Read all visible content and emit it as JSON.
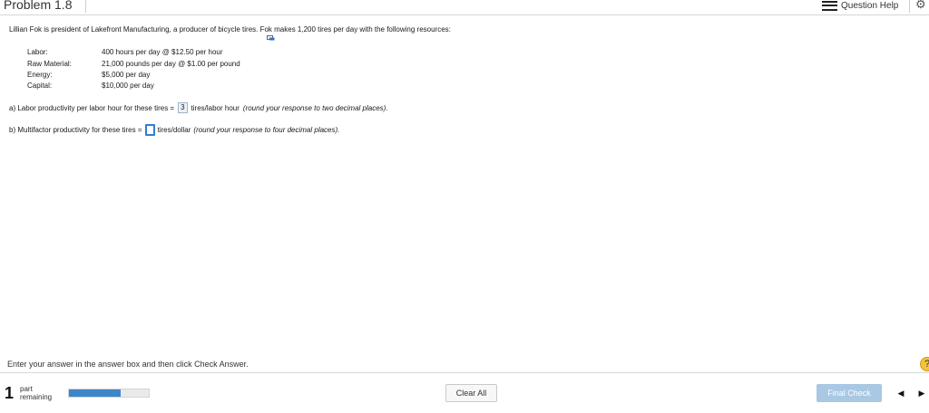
{
  "header": {
    "title": "Problem 1.8",
    "question_help": "Question Help",
    "icons": {
      "menu": "hamburger-icon",
      "settings": "gear-icon"
    }
  },
  "problem": {
    "intro": "Lillian Fok is president of Lakefront Manufacturing, a producer of bicycle tires. Fok makes 1,200 tires per day with the following resources:",
    "resources": [
      {
        "label": "Labor:",
        "value": "400 hours per day @ $12.50 per hour"
      },
      {
        "label": "Raw Material:",
        "value": "21,000 pounds per day @ $1.00 per pound"
      },
      {
        "label": "Energy:",
        "value": "$5,000 per day"
      },
      {
        "label": "Capital:",
        "value": "$10,000 per day"
      }
    ],
    "part_a": {
      "prefix": "a) Labor productivity per labor hour for these tires =",
      "answer": "3",
      "unit": "tires/labor hour",
      "hint": "(round your response to two decimal places)."
    },
    "part_b": {
      "prefix": "b) Multifactor productivity for these tires =",
      "answer": "",
      "unit": "tires/dollar",
      "hint": "(round your response to four decimal places)."
    }
  },
  "footer": {
    "instruction": "Enter your answer in the answer box and then click Check Answer.",
    "parts_remaining_count": "1",
    "parts_remaining_label_1": "part",
    "parts_remaining_label_2": "remaining",
    "progress_fraction": 0.65,
    "clear_all": "Clear All",
    "final_check": "Final Check",
    "help_bubble": "?",
    "nav_prev": "◀",
    "nav_next": "▶"
  },
  "colors": {
    "accent": "#3c86c9",
    "final_check_bg": "#a9c8e3",
    "help_bubble": "#f3c33b",
    "input_focus_border": "#2f7fd0"
  }
}
